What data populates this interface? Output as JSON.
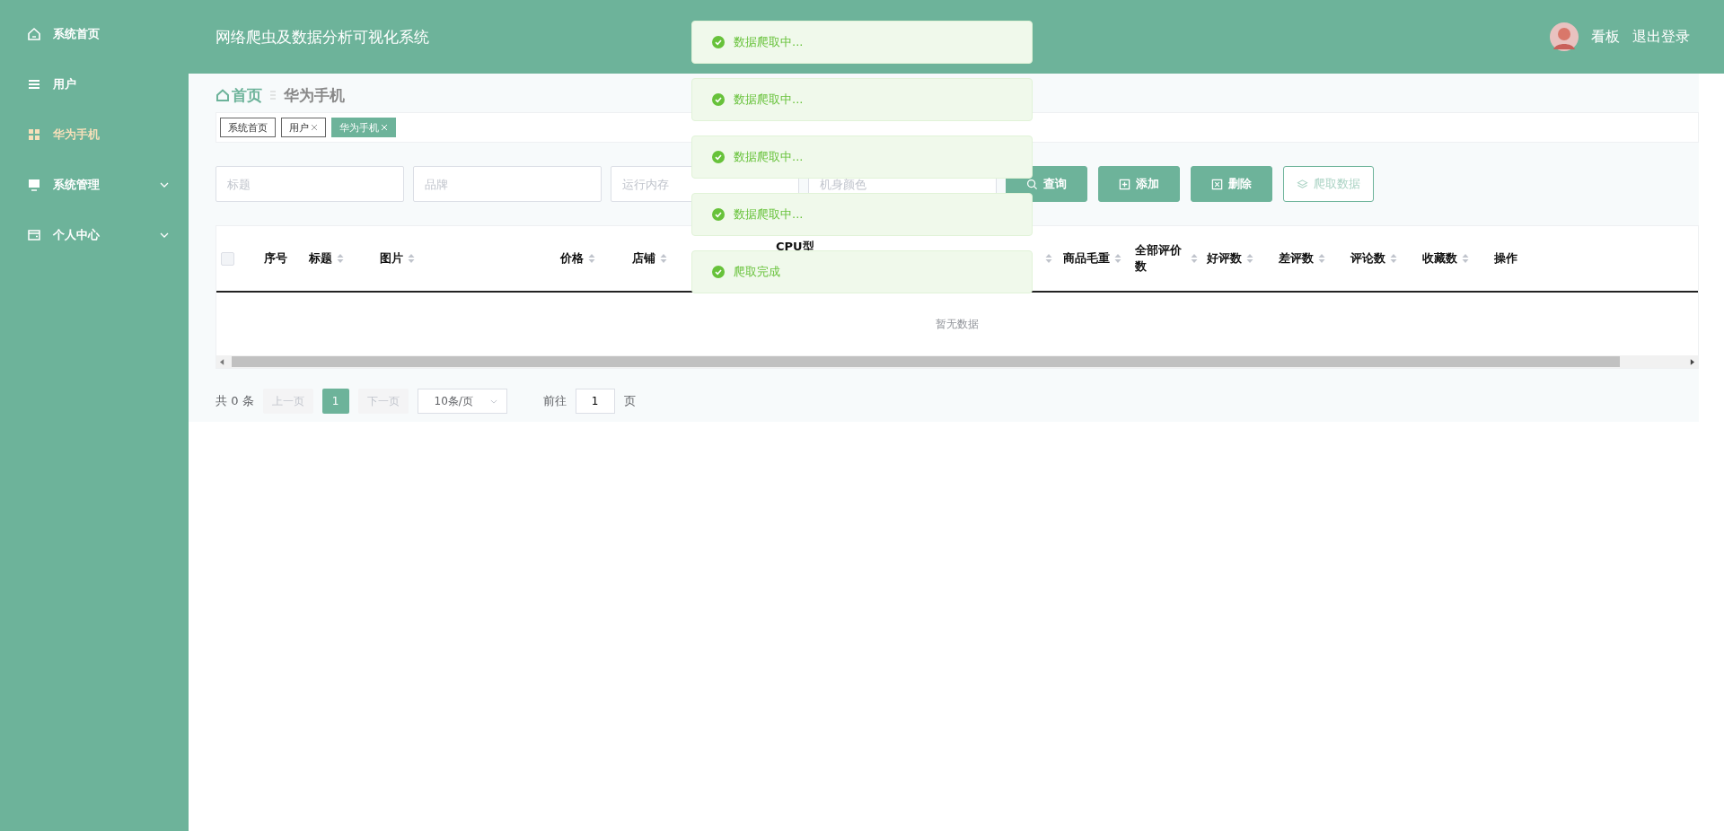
{
  "sidebar": {
    "items": [
      {
        "label": "系统首页",
        "selected": false,
        "expandable": false
      },
      {
        "label": "用户",
        "selected": false,
        "expandable": false
      },
      {
        "label": "华为手机",
        "selected": true,
        "expandable": false
      },
      {
        "label": "系统管理",
        "selected": false,
        "expandable": true
      },
      {
        "label": "个人中心",
        "selected": false,
        "expandable": true
      }
    ]
  },
  "header": {
    "title": "网络爬虫及数据分析可视化系统",
    "user": "看板",
    "logout": "退出登录"
  },
  "breadcrumb": [
    "首页",
    "华为手机"
  ],
  "tags": [
    {
      "label": "系统首页",
      "closable": false,
      "selected": false
    },
    {
      "label": "用户",
      "closable": true,
      "selected": false
    },
    {
      "label": "华为手机",
      "closable": true,
      "selected": true
    }
  ],
  "filters": [
    {
      "placeholder": "标题"
    },
    {
      "placeholder": "品牌"
    },
    {
      "placeholder": "运行内存"
    },
    {
      "placeholder": "机身颜色"
    }
  ],
  "buttons": [
    {
      "label": "查询",
      "kind": "primary"
    },
    {
      "label": "添加",
      "kind": "primary"
    },
    {
      "label": "删除",
      "kind": "primary"
    },
    {
      "label": "爬取数据",
      "kind": "plain"
    }
  ],
  "table": {
    "select_all": {
      "checked": false
    },
    "columns": [
      {
        "label": "序号",
        "sortable": false
      },
      {
        "label": "标题",
        "sortable": true
      },
      {
        "label": "图片",
        "sortable": true
      },
      {
        "label": "价格",
        "sortable": true
      },
      {
        "label": "店铺",
        "sortable": true
      },
      {
        "label": "CPU型",
        "sortable": false
      },
      {
        "sortable": true
      },
      {
        "label": "商品毛重",
        "sortable": true
      },
      {
        "label": "全部评价数",
        "sortable": true
      },
      {
        "label": "好评数",
        "sortable": true
      },
      {
        "label": "差评数",
        "sortable": true
      },
      {
        "label": "评论数",
        "sortable": true
      },
      {
        "label": "收藏数",
        "sortable": true
      },
      {
        "label": "操作",
        "sortable": false
      }
    ],
    "empty": "暂无数据"
  },
  "pagination": {
    "total": "共 0 条",
    "prev": "上一页",
    "pages": [
      {
        "label": "1",
        "selected": true
      }
    ],
    "next": "下一页",
    "page_size": "10条/页",
    "goto": "前往",
    "goto_value": "1",
    "page_unit": "页"
  },
  "toasts": [
    {
      "text": "数据爬取中...",
      "kind": "success"
    },
    {
      "text": "数据爬取中...",
      "kind": "success"
    },
    {
      "text": "数据爬取中...",
      "kind": "success"
    },
    {
      "text": "数据爬取中...",
      "kind": "success"
    },
    {
      "text": "爬取完成",
      "kind": "success"
    }
  ]
}
